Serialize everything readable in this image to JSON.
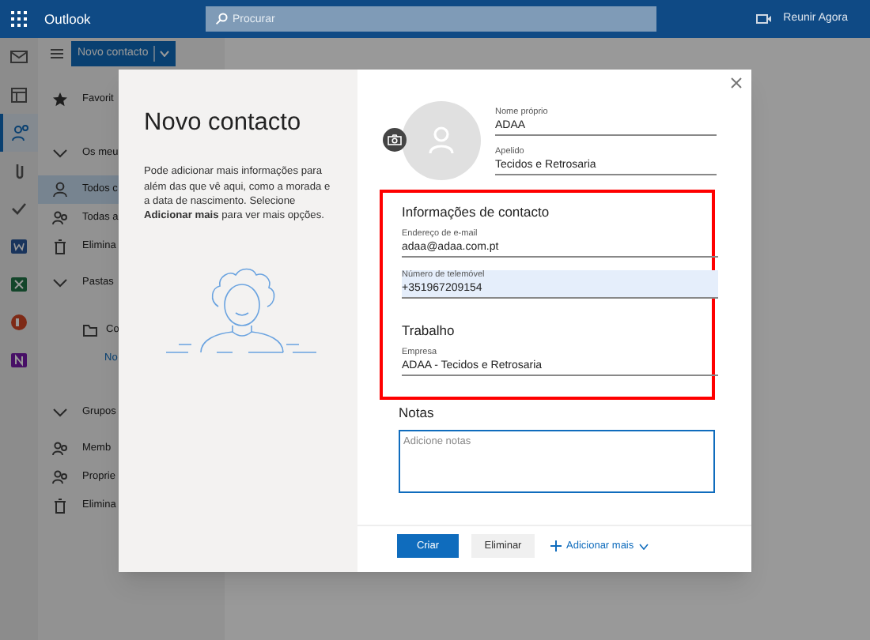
{
  "app_bar": {
    "app_name": "Outlook",
    "search": {
      "placeholder": "Procurar"
    },
    "meet_now": "Reunir Agora"
  },
  "rail": [
    {
      "kind": "mail",
      "selected": false
    },
    {
      "kind": "calendar",
      "selected": false
    },
    {
      "kind": "people",
      "selected": true
    },
    {
      "kind": "attach",
      "selected": false
    },
    {
      "kind": "check",
      "selected": false
    },
    {
      "kind": "word",
      "selected": false
    },
    {
      "kind": "excel",
      "selected": false
    },
    {
      "kind": "powerpoint",
      "selected": false
    },
    {
      "kind": "onenote",
      "selected": false
    }
  ],
  "nav": {
    "new_button": "Novo contacto",
    "items": [
      {
        "kind": "star",
        "label": "Favorit",
        "selected": false
      },
      {
        "kind": "chevron",
        "label": "Os meu",
        "selected": false
      },
      {
        "kind": "person",
        "label": "Todos c",
        "selected": true
      },
      {
        "kind": "people",
        "label": "Todas a",
        "selected": false
      },
      {
        "kind": "trash",
        "label": "Elimina",
        "selected": false
      },
      {
        "kind": "chevron",
        "label": "Pastas",
        "selected": false
      },
      {
        "kind": "folder",
        "label": "Co",
        "selected": false
      },
      {
        "kind": "link",
        "label": "No",
        "selected": false
      },
      {
        "kind": "chevron",
        "label": "Grupos",
        "selected": false
      },
      {
        "kind": "people",
        "label": "Memb",
        "selected": false
      },
      {
        "kind": "people",
        "label": "Proprie",
        "selected": false
      },
      {
        "kind": "trash",
        "label": "Elimina",
        "selected": false
      }
    ]
  },
  "dialog": {
    "title": "Novo contacto",
    "intro": "Pode adicionar mais informações para além das que vê aqui, como a morada e a data de nascimento. Selecione **Adicionar mais** para ver mais opções.",
    "name_fields": [
      {
        "label": "Nome próprio",
        "value": "ADAA"
      },
      {
        "label": "Apelido",
        "value": "Tecidos e Retrosaria"
      }
    ],
    "sections": [
      {
        "heading": "Informações de contacto",
        "fields": [
          {
            "label": "Endereço de e-mail",
            "value": "adaa@adaa.com.pt",
            "focused": false
          },
          {
            "label": "Número de telemóvel",
            "value": "+351967209154",
            "focused": true
          }
        ]
      },
      {
        "heading": "Trabalho",
        "fields": [
          {
            "label": "Empresa",
            "value": "ADAA - Tecidos e Retrosaria",
            "focused": false
          }
        ]
      }
    ],
    "notes": {
      "heading": "Notas",
      "placeholder": "Adicione notas"
    },
    "buttons": {
      "primary": "Criar",
      "secondary": "Eliminar",
      "add_more": "Adicionar mais"
    }
  }
}
